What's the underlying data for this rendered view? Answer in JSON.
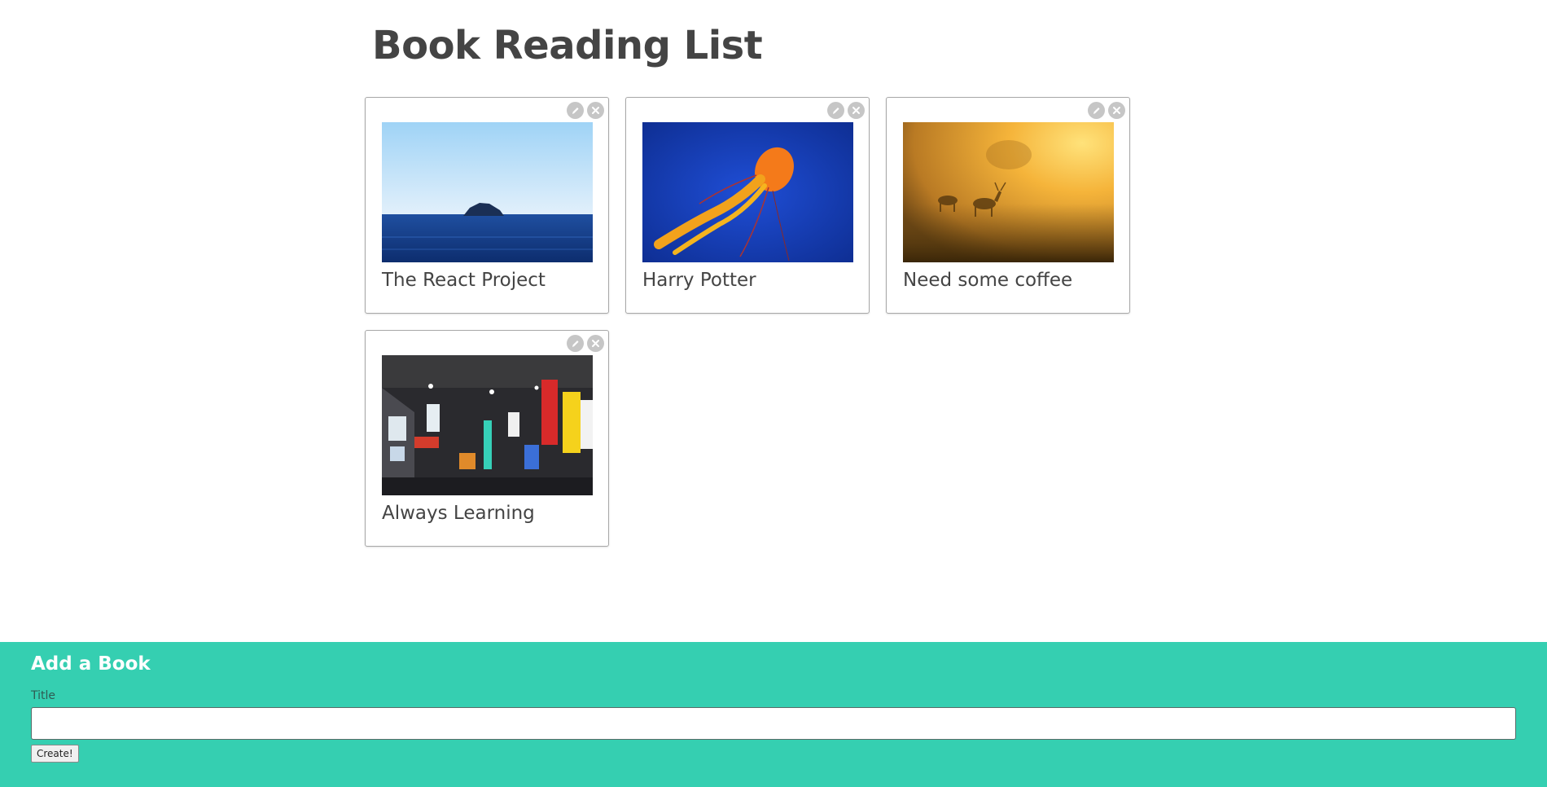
{
  "header": {
    "title": "Book Reading List"
  },
  "books": [
    {
      "title": "The React Project",
      "image": "sea-island-photo",
      "edit_icon": "pencil-icon",
      "delete_icon": "close-icon"
    },
    {
      "title": "Harry Potter",
      "image": "jellyfish-photo",
      "edit_icon": "pencil-icon",
      "delete_icon": "close-icon"
    },
    {
      "title": "Need some coffee",
      "image": "deer-sunrise-photo",
      "edit_icon": "pencil-icon",
      "delete_icon": "close-icon"
    },
    {
      "title": "Always Learning",
      "image": "city-night-photo",
      "edit_icon": "pencil-icon",
      "delete_icon": "close-icon"
    }
  ],
  "add_form": {
    "heading": "Add a Book",
    "title_label": "Title",
    "title_value": "",
    "submit_label": "Create!"
  },
  "colors": {
    "accent": "#35cfb1",
    "text": "#444444",
    "card_border": "#a8a8a8",
    "action_icon_bg": "#c6c6c6"
  }
}
